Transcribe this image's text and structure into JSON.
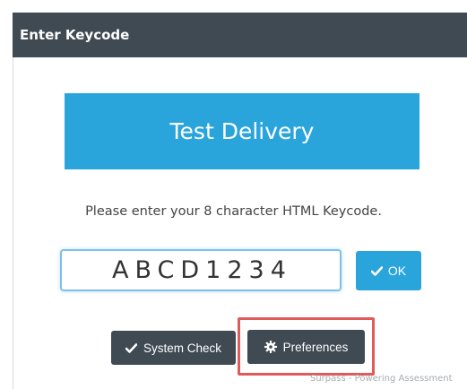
{
  "dialog": {
    "title": "Enter Keycode",
    "banner": "Test Delivery",
    "instruction": "Please enter your 8 character HTML Keycode.",
    "keycode": {
      "value": "ABCD1234",
      "placeholder": ""
    },
    "ok_label": "OK",
    "system_check_label": "System Check",
    "preferences_label": "Preferences"
  },
  "footer": {
    "text": "Surpass - Powering Assessment"
  },
  "colors": {
    "header": "#3f4a53",
    "accent": "#2aa5dc",
    "dark_button": "#3f4a53",
    "highlight": "#e05a5a"
  },
  "icons": {
    "ok": "checkmark-icon",
    "system_check": "checkmark-icon",
    "preferences": "gear-icon"
  }
}
